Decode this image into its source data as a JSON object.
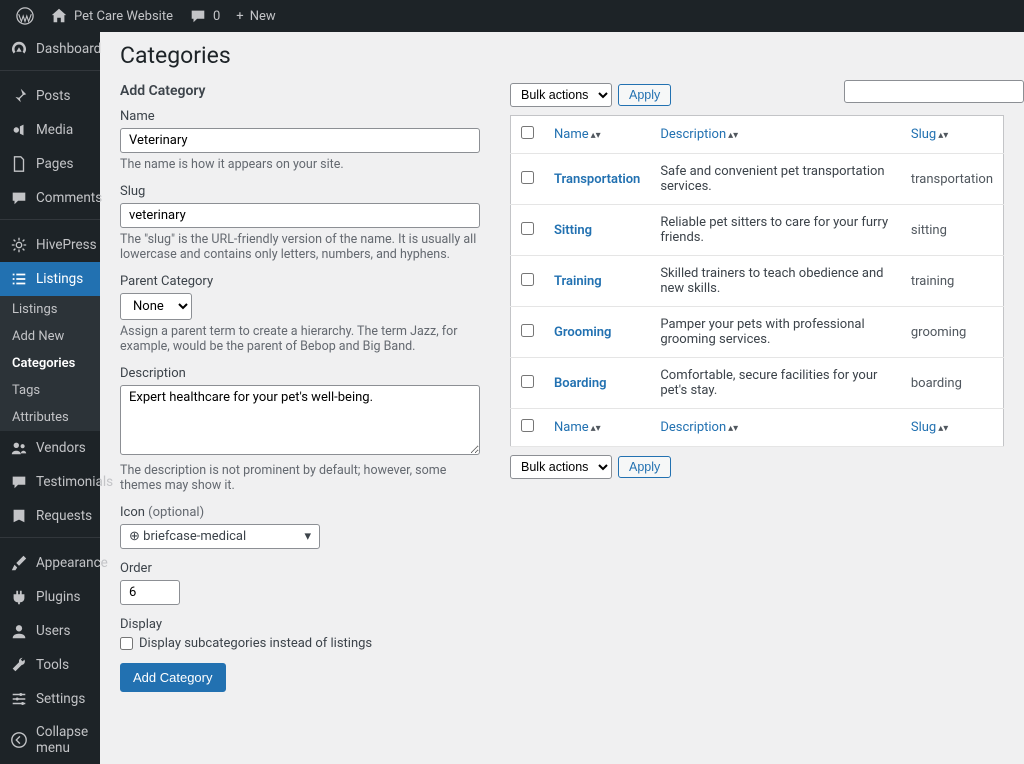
{
  "adminBar": {
    "siteName": "Pet Care Website",
    "commentsCount": "0",
    "newLabel": "New"
  },
  "sidebar": {
    "dashboard": "Dashboard",
    "posts": "Posts",
    "media": "Media",
    "pages": "Pages",
    "comments": "Comments",
    "hivepress": "HivePress",
    "listings": "Listings",
    "submenu": {
      "listings": "Listings",
      "addNew": "Add New",
      "categories": "Categories",
      "tags": "Tags",
      "attributes": "Attributes"
    },
    "vendors": "Vendors",
    "testimonials": "Testimonials",
    "requests": "Requests",
    "appearance": "Appearance",
    "plugins": "Plugins",
    "users": "Users",
    "tools": "Tools",
    "settings": "Settings",
    "collapse": "Collapse menu"
  },
  "page": {
    "title": "Categories",
    "addHeading": "Add Category",
    "name": {
      "label": "Name",
      "value": "Veterinary",
      "help": "The name is how it appears on your site."
    },
    "slug": {
      "label": "Slug",
      "value": "veterinary",
      "help": "The \"slug\" is the URL-friendly version of the name. It is usually all lowercase and contains only letters, numbers, and hyphens."
    },
    "parent": {
      "label": "Parent Category",
      "selected": "None",
      "help": "Assign a parent term to create a hierarchy. The term Jazz, for example, would be the parent of Bebop and Big Band."
    },
    "description": {
      "label": "Description",
      "value": "Expert healthcare for your pet's well-being.",
      "help": "The description is not prominent by default; however, some themes may show it."
    },
    "icon": {
      "label": "Icon",
      "optional": "(optional)",
      "value": "briefcase-medical"
    },
    "order": {
      "label": "Order",
      "value": "6"
    },
    "display": {
      "label": "Display",
      "checkboxLabel": "Display subcategories instead of listings"
    },
    "submit": "Add Category"
  },
  "table": {
    "bulkActions": "Bulk actions",
    "apply": "Apply",
    "headers": {
      "name": "Name",
      "description": "Description",
      "slug": "Slug"
    },
    "rows": [
      {
        "name": "Transportation",
        "description": "Safe and convenient pet transportation services.",
        "slug": "transportation"
      },
      {
        "name": "Sitting",
        "description": "Reliable pet sitters to care for your furry friends.",
        "slug": "sitting"
      },
      {
        "name": "Training",
        "description": "Skilled trainers to teach obedience and new skills.",
        "slug": "training"
      },
      {
        "name": "Grooming",
        "description": "Pamper your pets with professional grooming services.",
        "slug": "grooming"
      },
      {
        "name": "Boarding",
        "description": "Comfortable, secure facilities for your pet's stay.",
        "slug": "boarding"
      }
    ]
  }
}
